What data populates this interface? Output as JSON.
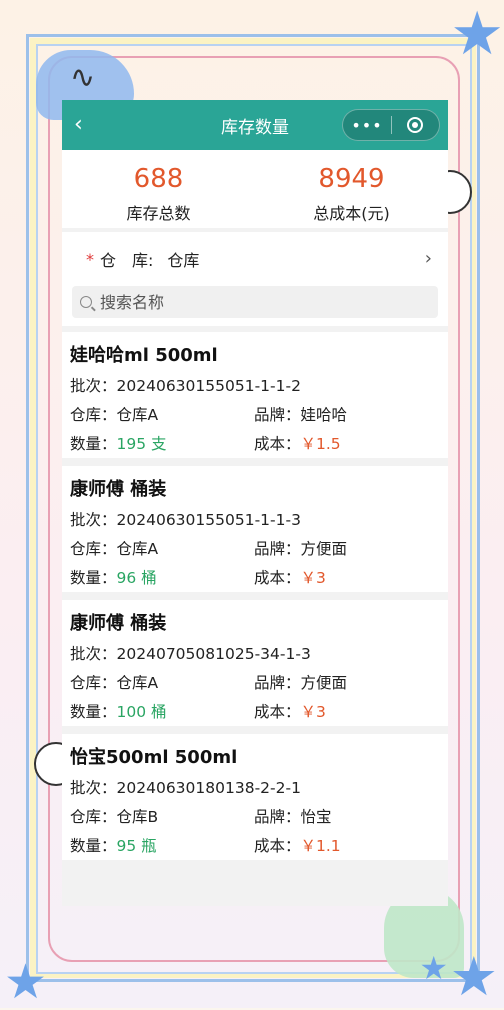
{
  "nav": {
    "title": "库存数量",
    "more_icon": "•••"
  },
  "summary": {
    "total_qty": {
      "value": "688",
      "label": "库存总数"
    },
    "total_cost": {
      "value": "8949",
      "label": "总成本(元)"
    }
  },
  "filter": {
    "required_mark": "*",
    "warehouse_label": "仓　库:",
    "warehouse_value": "仓库",
    "search_placeholder": "搜索名称"
  },
  "labels": {
    "batch": "批次：",
    "warehouse": "仓库：",
    "brand": "品牌：",
    "qty": "数量：",
    "cost": "成本："
  },
  "items": [
    {
      "name": "娃哈哈ml 500ml",
      "batch": "20240630155051-1-1-2",
      "warehouse": "仓库A",
      "brand": "娃哈哈",
      "qty": "195 支",
      "cost": "￥1.5"
    },
    {
      "name": "康师傅 桶装",
      "batch": "20240630155051-1-1-3",
      "warehouse": "仓库A",
      "brand": "方便面",
      "qty": "96 桶",
      "cost": "￥3"
    },
    {
      "name": "康师傅 桶装",
      "batch": "20240705081025-34-1-3",
      "warehouse": "仓库A",
      "brand": "方便面",
      "qty": "100 桶",
      "cost": "￥3"
    },
    {
      "name": "怡宝500ml 500ml",
      "batch": "20240630180138-2-2-1",
      "warehouse": "仓库B",
      "brand": "怡宝",
      "qty": "95 瓶",
      "cost": "￥1.1"
    }
  ]
}
